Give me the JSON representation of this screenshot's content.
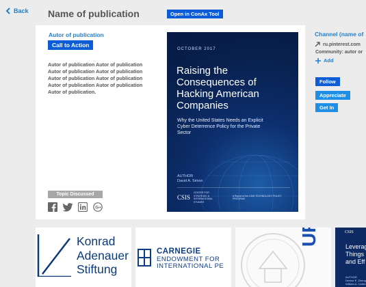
{
  "nav": {
    "back_label": "Back"
  },
  "header": {
    "title": "Name of publication",
    "open_button": "Open in ConAx Tool"
  },
  "publication": {
    "author_link": "Autor of publication",
    "cta_label": "Call to Action",
    "description": "Autor of publication Autor of publication Autor of publication Autor of publication Autor of publication Autor of publication Autor of publication Autor of publication Autor of publication.",
    "topic_label": "Topic Discussed",
    "social_icons": [
      "facebook-icon",
      "twitter-icon",
      "linkedin-icon",
      "google-plus-icon"
    ]
  },
  "cover": {
    "date": "OCTOBER 2017",
    "title": "Raising the Consequences of Hacking American Companies",
    "subtitle": "Why the United States Needs an Explicit Cyber Deterrence Policy for the Private Sector",
    "author_label": "AUTHOR",
    "author_name": "David A. Simon",
    "org_logo": "CSIS",
    "org_name": "CENTER FOR STRATEGIC & INTERNATIONAL STUDIES",
    "report_note": "A Report of the CSIS TECHNOLOGY POLICY PROGRAM"
  },
  "sidebar": {
    "channel": "Channel (name of",
    "link": "ru.pinterest.com",
    "community": "Community: autor or",
    "add_label": "Add",
    "follow_label": "Follow",
    "appreciate_label": "Appreciate",
    "getin_label": "Get In"
  },
  "related": {
    "kas_line1": "Konrad",
    "kas_line2": "Adenauer",
    "kas_line3": "Stiftung",
    "carnegie_name": "CARNEGIE",
    "carnegie_line2": "ENDOWMENT FOR",
    "carnegie_line3": "INTERNATIONAL PE",
    "urg_text": "URG",
    "t4_org": "CSIS",
    "t4_line1": "Leverag",
    "t4_line2": "Things",
    "t4_line3": "and Eff",
    "t4_author_label": "AUTHOR",
    "t4_authors": "Denise E. Zheng\nWilliam A. Carter"
  },
  "colors": {
    "brand_blue": "#0b5cd6",
    "link_blue": "#1f7fd0",
    "light_blue": "#1e8fe6",
    "cover_navy": "#08214f"
  }
}
